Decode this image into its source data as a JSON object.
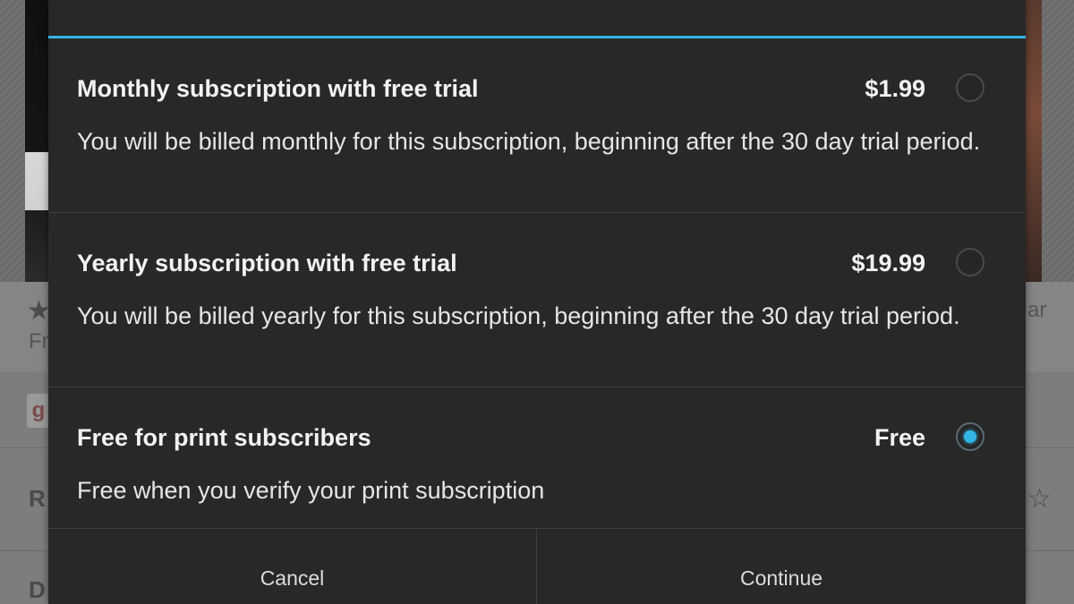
{
  "theme": {
    "accent": "#33b5e5",
    "dialog_bg": "#282828"
  },
  "background": {
    "partial_texts": [
      "Fr",
      "ar",
      "R",
      "D",
      "g"
    ],
    "star_icon": "star-icon"
  },
  "dialog": {
    "options": [
      {
        "title": "Monthly subscription with free trial",
        "price": "$1.99",
        "description": "You will be billed monthly for this subscription, beginning after the 30 day trial period.",
        "selected": false
      },
      {
        "title": "Yearly subscription with free trial",
        "price": "$19.99",
        "description": "You will be billed yearly for this subscription, beginning after the 30 day trial period.",
        "selected": false
      },
      {
        "title": "Free for print subscribers",
        "price": "Free",
        "description": "Free when you verify your print subscription",
        "selected": true
      }
    ],
    "buttons": {
      "cancel": "Cancel",
      "continue": "Continue"
    }
  }
}
